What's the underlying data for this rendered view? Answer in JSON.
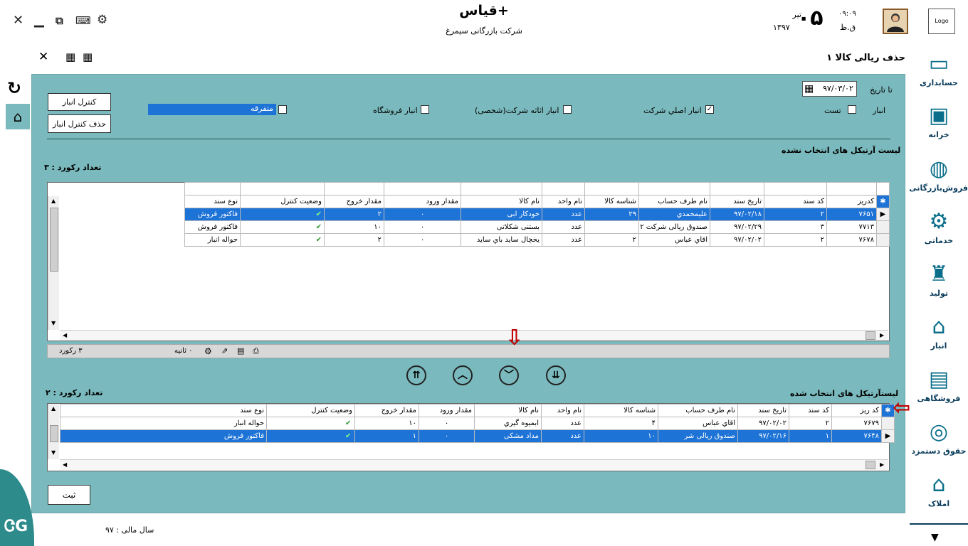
{
  "window": {
    "close_icon": "close-icon",
    "minimize_icon": "minimize-icon",
    "restore_icon": "restore-icon",
    "keyboard_icon": "keyboard-icon",
    "settings_icon": "gear-icon"
  },
  "header": {
    "app_title": "قیاس+",
    "company": "شرکت بازرگانی سیمرغ",
    "day": "۰۵",
    "month": "تیر",
    "year": "۱۳۹۷",
    "time": "۰۹:۰۹",
    "ampm": "ق.ظ",
    "logo_text": "Logo"
  },
  "form": {
    "title": "حذف ریالی کالا ۱"
  },
  "filters": {
    "to_date_label": "تا تاریخ",
    "to_date_value": "۹۷/۰۳/۰۲",
    "warehouse_label": "انبار",
    "options": [
      {
        "label": "تست",
        "checked": false
      },
      {
        "label": "انبار اصلي شركت",
        "checked": true
      },
      {
        "label": "انبار اثاثه شرکت(شخصی)",
        "checked": false
      },
      {
        "label": "انبار فروشگاه",
        "checked": false
      },
      {
        "label": "متفرقه",
        "checked": false
      }
    ],
    "btn_control": "کنترل انبار",
    "btn_remove_control": "حذف کنترل انبار"
  },
  "unselected": {
    "title": "لیست آرتیکل های انتخاب نشده",
    "count_label": "تعداد رکورد : ۳",
    "columns": [
      "کدریز",
      "کد سند",
      "تاریخ سند",
      "نام طرف حساب",
      "شناسه کالا",
      "نام واحد",
      "نام کالا",
      "مقدار ورود",
      "مقدار خروج",
      "وضعیت کنترل",
      "نوع سند"
    ],
    "rows": [
      [
        "۷۶۵۱",
        "۲",
        "۹۷/۰۲/۱۸",
        "علیمحمدي",
        "۲۹",
        "عدد",
        "خودکار ابی",
        "۰",
        "۲",
        "✔",
        "فاکتور فروش"
      ],
      [
        "۷۷۱۳",
        "۳",
        "۹۷/۰۲/۲۹",
        "صندوق ریالی شرکت ۱۲",
        "",
        "عدد",
        "بستنی شکلاتی",
        "۰",
        "۱۰",
        "✔",
        "فاکتور فروش"
      ],
      [
        "۷۶۷۸",
        "۲",
        "۹۷/۰۲/۰۲",
        "اقاي عباس",
        "۲",
        "عدد",
        "يخچال ساید باي ساید",
        "۰",
        "۲",
        "✔",
        "حواله انبار"
      ]
    ],
    "status_records": "۳ رکورد",
    "status_seconds": "۰ ثانیه"
  },
  "nav_buttons": {
    "move_all_up": "move-all-up-icon",
    "move_up": "move-up-icon",
    "move_down": "move-down-icon",
    "move_all_down": "move-all-down-icon"
  },
  "selected": {
    "title": "لیستآرتیکل های انتخاب شده",
    "count_label": "تعداد رکورد : ۲",
    "columns": [
      "کد ریز",
      "کد سند",
      "تاریخ سند",
      "نام طرف حساب",
      "شناسه کالا",
      "نام واحد",
      "نام کالا",
      "مقدار ورود",
      "مقدار خروج",
      "وضعیت کنترل",
      "نوع سند"
    ],
    "rows": [
      [
        "۷۶۷۹",
        "۲",
        "۹۷/۰۲/۰۲",
        "اقاي عباس",
        "۴",
        "عدد",
        "ابمیوه گيري",
        "۰",
        "۱۰",
        "✔",
        "حواله انبار"
      ],
      [
        "۷۶۴۸",
        "۱",
        "۹۷/۰۲/۱۶",
        "صندوق ریالی شر",
        "۱۰",
        "عدد",
        "مداد مشکی",
        "۰",
        "۱",
        "✔",
        "فاکتور فروش"
      ]
    ]
  },
  "submit_label": "ثبت",
  "fiscal_year": "سال مالی : ۹۷",
  "sidebar": {
    "items": [
      {
        "label": "حسابداری",
        "icon": "accounting-icon"
      },
      {
        "label": "خزانه",
        "icon": "safe-icon"
      },
      {
        "label": "فروش‌بازرگانی",
        "icon": "globe-trade-icon"
      },
      {
        "label": "خدماتی",
        "icon": "gear-service-icon"
      },
      {
        "label": "تولید",
        "icon": "production-icon"
      },
      {
        "label": "انبار",
        "icon": "warehouse-icon"
      },
      {
        "label": "فروشگاهی",
        "icon": "store-icon"
      },
      {
        "label": "حقوق دستمزد",
        "icon": "coins-icon"
      },
      {
        "label": "املاک",
        "icon": "real-estate-icon"
      }
    ]
  },
  "colors": {
    "panel": "#7ab9bd",
    "selected_row": "#1e73d6",
    "sidebar_icon": "#0a6e8a",
    "arrow": "#c00000"
  }
}
